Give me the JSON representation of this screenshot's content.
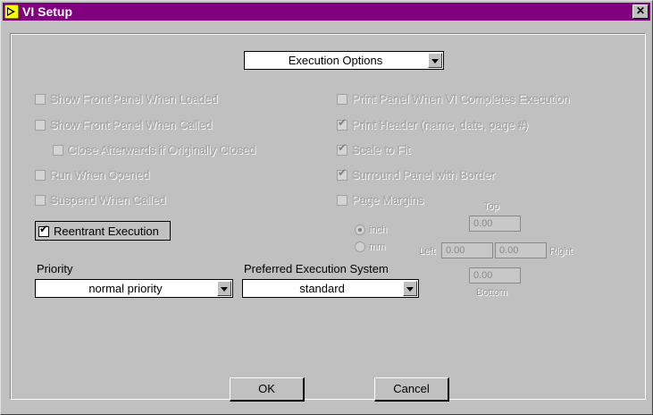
{
  "window": {
    "title": "VI Setup",
    "close_glyph": "✕"
  },
  "category": {
    "selected": "Execution Options"
  },
  "left_options": [
    {
      "label": "Show Front Panel When Loaded",
      "checked": false,
      "enabled": false
    },
    {
      "label": "Show Front Panel When Called",
      "checked": false,
      "enabled": false
    },
    {
      "label": "Close Afterwards if Originally Closed",
      "checked": false,
      "enabled": false
    },
    {
      "label": "Run When Opened",
      "checked": false,
      "enabled": false
    },
    {
      "label": "Suspend When Called",
      "checked": false,
      "enabled": false
    }
  ],
  "reentrant": {
    "label": "Reentrant Execution",
    "checked": true
  },
  "right_options": [
    {
      "label": "Print Panel When VI Completes Execution",
      "checked": false,
      "enabled": false
    },
    {
      "label": "Print Header (name, date, page #)",
      "checked": true,
      "enabled": false
    },
    {
      "label": "Scale to Fit",
      "checked": true,
      "enabled": false
    },
    {
      "label": "Surround Panel with Border",
      "checked": true,
      "enabled": false
    },
    {
      "label": "Page Margins",
      "checked": false,
      "enabled": false
    }
  ],
  "margins": {
    "top_label": "Top",
    "left_label": "Left",
    "right_label": "Right",
    "bottom_label": "Bottom",
    "top_value": "0.00",
    "left_value": "0.00",
    "right_value": "0.00",
    "bottom_value": "0.00",
    "unit_inch": "inch",
    "unit_mm": "mm"
  },
  "priority": {
    "label": "Priority",
    "selected": "normal priority"
  },
  "exec_system": {
    "label": "Preferred Execution System",
    "selected": "standard"
  },
  "buttons": {
    "ok": "OK",
    "cancel": "Cancel"
  },
  "colors": {
    "titlebar": "#800080",
    "face": "#c0c0c0"
  },
  "icons": {
    "app": "labview-vi-icon",
    "check": "checkmark-icon"
  }
}
